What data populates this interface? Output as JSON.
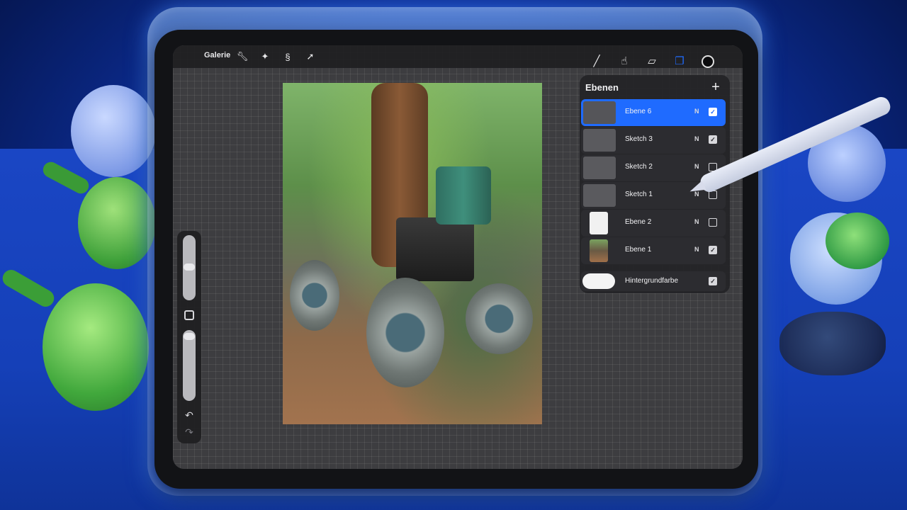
{
  "toolbar": {
    "gallery_label": "Galerie",
    "left_icons": [
      "wrench-icon",
      "magic-wand-icon",
      "selection-icon",
      "transform-arrow-icon"
    ],
    "right_icons": [
      "brush-icon",
      "smudge-icon",
      "eraser-icon",
      "layers-icon",
      "color-icon"
    ]
  },
  "layers_panel": {
    "title": "Ebenen",
    "add_glyph": "+",
    "layers": [
      {
        "name": "Ebene 6",
        "blend": "N",
        "visible": true,
        "active": true,
        "thumb": "empty"
      },
      {
        "name": "Sketch 3",
        "blend": "N",
        "visible": true,
        "active": false,
        "thumb": "sketch"
      },
      {
        "name": "Sketch 2",
        "blend": "N",
        "visible": false,
        "active": false,
        "thumb": "sketch"
      },
      {
        "name": "Sketch 1",
        "blend": "N",
        "visible": false,
        "active": false,
        "thumb": "sketch"
      },
      {
        "name": "Ebene 2",
        "blend": "N",
        "visible": false,
        "active": false,
        "thumb": "white"
      },
      {
        "name": "Ebene 1",
        "blend": "N",
        "visible": true,
        "active": false,
        "thumb": "photo"
      }
    ],
    "background": {
      "name": "Hintergrundfarbe",
      "visible": true
    }
  },
  "colors": {
    "accent": "#1f6bff",
    "panel": "#242428",
    "canvas_grid": "#3d3d40"
  }
}
